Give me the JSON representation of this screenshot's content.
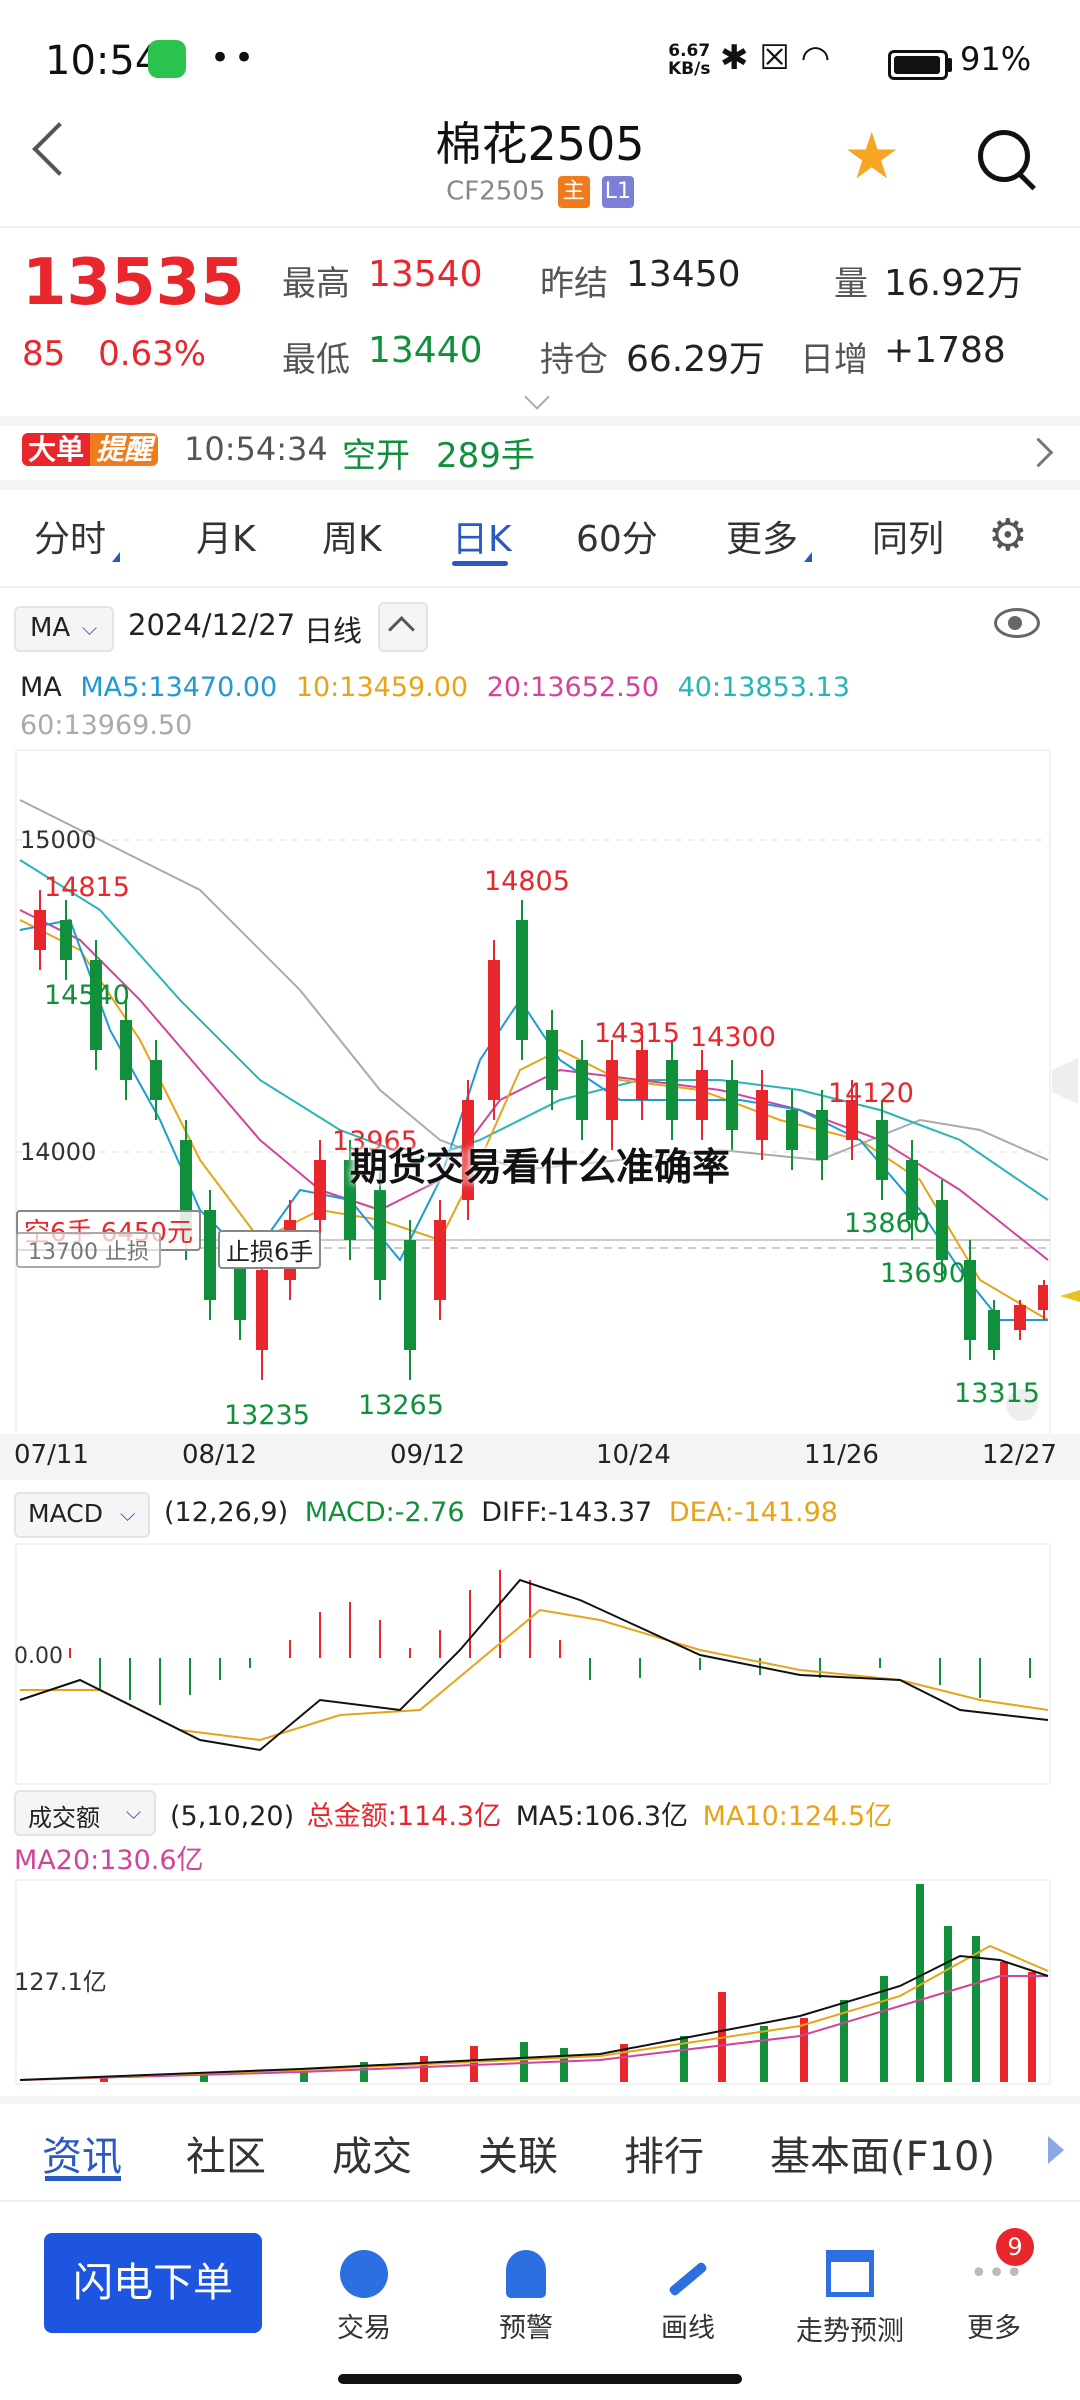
{
  "status_bar": {
    "time": "10:54",
    "dots": "••",
    "net_speed": "6.67",
    "net_unit": "KB/s",
    "battery": "91%"
  },
  "header": {
    "title": "棉花2505",
    "code": "CF2505",
    "tag_main": "主",
    "tag_l1": "L1"
  },
  "quote": {
    "price": "13535",
    "change": "85",
    "change_pct": "0.63%",
    "stats": [
      {
        "label": "最高",
        "value": "13540",
        "color": "red"
      },
      {
        "label": "昨结",
        "value": "13450",
        "color": "black"
      },
      {
        "label": "量",
        "value": "16.92万",
        "color": "black"
      },
      {
        "label": "最低",
        "value": "13440",
        "color": "green"
      },
      {
        "label": "持仓",
        "value": "66.29万",
        "color": "black"
      },
      {
        "label": "日增",
        "value": "+1788",
        "color": "black"
      }
    ]
  },
  "alert": {
    "badge_a": "大单",
    "badge_b": "提醒",
    "time": "10:54:34",
    "action": "空开",
    "volume": "289手"
  },
  "chart_tabs": [
    "分时",
    "月K",
    "周K",
    "日K",
    "60分",
    "更多",
    "同列"
  ],
  "kline": {
    "indicator": "MA",
    "date": "2024/12/27",
    "period": "日线",
    "ma_label": "MA",
    "ma": [
      {
        "text": "MA5:13470.00",
        "color": "#1f9ad6"
      },
      {
        "text": "10:13459.00",
        "color": "#e8a317"
      },
      {
        "text": "20:13652.50",
        "color": "#d2439b"
      },
      {
        "text": "40:13853.13",
        "color": "#27b5b5"
      },
      {
        "text": "60:13969.50",
        "color": "#aaaaaa"
      }
    ],
    "y_ticks": [
      "15000",
      "14000"
    ],
    "price_labels": [
      "14815",
      "14540",
      "14805",
      "14315",
      "14300",
      "14120",
      "13965",
      "13860",
      "13690",
      "13315",
      "13235",
      "13265"
    ],
    "position_label": "空6手  6450元",
    "stop_label": "13700  止损",
    "stop_tail": "止损6手",
    "dates": [
      "07/11",
      "08/12",
      "09/12",
      "10/24",
      "11/26",
      "12/27"
    ]
  },
  "overlay_title": "期货交易看什么准确率",
  "macd": {
    "name": "MACD",
    "params": "(12,26,9)",
    "macd": "MACD:-2.76",
    "diff": "DIFF:-143.37",
    "dea": "DEA:-141.98",
    "zero": "0.00"
  },
  "volume": {
    "name": "成交额",
    "params": "(5,10,20)",
    "total": "总金额:114.3亿",
    "ma5": "MA5:106.3亿",
    "ma10": "MA10:124.5亿",
    "ma20": "MA20:130.6亿",
    "y_tick": "127.1亿"
  },
  "bottom_tabs": [
    "资讯",
    "社区",
    "成交",
    "关联",
    "排行",
    "基本面(F10)"
  ],
  "toolbar": {
    "order_button": "闪电下单",
    "tools": [
      {
        "label": "交易",
        "icon": "trade-icon"
      },
      {
        "label": "预警",
        "icon": "bell-icon"
      },
      {
        "label": "画线",
        "icon": "pen-icon"
      },
      {
        "label": "走势预测",
        "icon": "forecast-icon"
      },
      {
        "label": "更多",
        "icon": "more-icon"
      }
    ],
    "more_badge": "9"
  },
  "chart_data": {
    "type": "candlestick",
    "x_range": [
      "07/11",
      "12/27"
    ],
    "ylim": [
      13100,
      15100
    ],
    "highs": [
      14815,
      14805,
      14315,
      14300,
      14120
    ],
    "lows": [
      13235,
      13265,
      13315
    ],
    "last_close": 13535
  }
}
